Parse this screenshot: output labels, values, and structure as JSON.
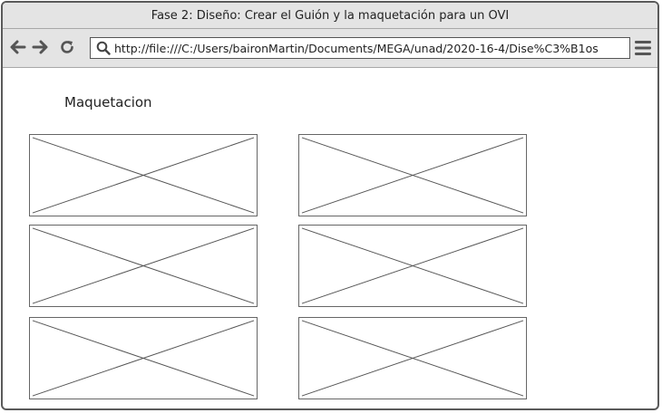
{
  "window": {
    "title": "Fase 2: Diseño: Crear el Guión y la maquetación para un OVI"
  },
  "toolbar": {
    "back_icon": "back-arrow-icon",
    "forward_icon": "forward-arrow-icon",
    "reload_icon": "reload-icon",
    "url": "http://file:///C:/Users/baironMartin/Documents/MEGA/unad/2020-16-4/Dise%C3%B1os",
    "menu_icon": "hamburger-menu-icon"
  },
  "main": {
    "heading": "Maquetacion",
    "image_placeholders": [
      "image-placeholder",
      "image-placeholder",
      "image-placeholder",
      "image-placeholder",
      "image-placeholder",
      "image-placeholder"
    ]
  },
  "colors": {
    "chrome_bg": "#e4e4e4",
    "border": "#5a5a5a",
    "stroke": "#555555"
  }
}
